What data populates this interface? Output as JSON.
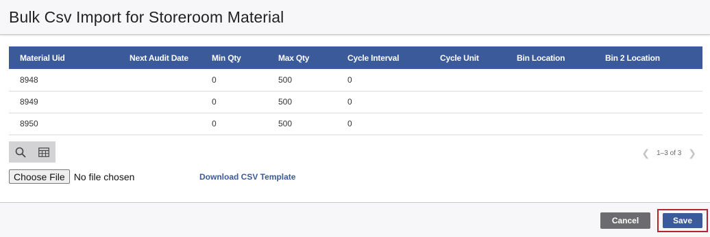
{
  "page": {
    "title": "Bulk Csv Import for Storeroom Material"
  },
  "table": {
    "columns": [
      "Material Uid",
      "Next Audit Date",
      "Min Qty",
      "Max Qty",
      "Cycle Interval",
      "Cycle Unit",
      "Bin Location",
      "Bin 2 Location"
    ],
    "rows": [
      [
        "8948",
        "",
        "0",
        "500",
        "0",
        "",
        "",
        ""
      ],
      [
        "8949",
        "",
        "0",
        "500",
        "0",
        "",
        "",
        ""
      ],
      [
        "8950",
        "",
        "0",
        "500",
        "0",
        "",
        "",
        ""
      ]
    ]
  },
  "toolbar": {
    "search_icon": "search-icon",
    "columns_icon": "table-icon"
  },
  "pager": {
    "text": "1–3 of 3"
  },
  "file": {
    "button_label": "Choose File",
    "status": "No file chosen"
  },
  "download": {
    "label": "Download CSV Template"
  },
  "footer": {
    "cancel_label": "Cancel",
    "save_label": "Save"
  },
  "colors": {
    "accent": "#3b5a9a",
    "highlight": "#b0262b",
    "cancel": "#6c6c70"
  }
}
